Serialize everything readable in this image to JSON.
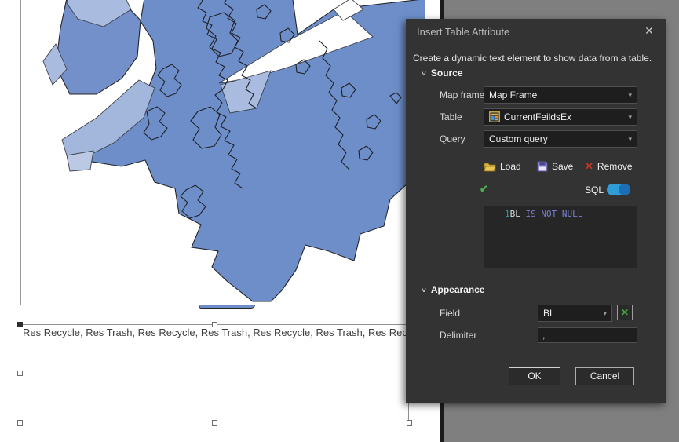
{
  "window": {
    "title": "Insert Table Attribute",
    "close_glyph": "✕"
  },
  "dialog": {
    "subtitle": "Create a dynamic text element to show data from a table.",
    "source": {
      "header": "Source",
      "map_frame_label": "Map frame",
      "map_frame_value": "Map Frame",
      "table_label": "Table",
      "table_value": "CurrentFeildsEx",
      "query_label": "Query",
      "query_value": "Custom query",
      "load_label": "Load",
      "save_label": "Save",
      "remove_label": "Remove",
      "sql_toggle_label": "SQL",
      "sql": {
        "line_number": "1",
        "field": "BL",
        "clause": "IS NOT NULL"
      }
    },
    "appearance": {
      "header": "Appearance",
      "field_label": "Field",
      "field_value": "BL",
      "delimiter_label": "Delimiter",
      "delimiter_value": ","
    },
    "buttons": {
      "ok": "OK",
      "cancel": "Cancel"
    }
  },
  "canvas": {
    "text_element": "Res Recycle, Res Trash, Res Recycle, Res Trash, Res Recycle, Res Trash, Res Recycle, Res Trash, Res Recycle, Res Trash"
  },
  "icons": {
    "chevron_down": "∨",
    "dropdown_caret": "▾",
    "check": "✔",
    "remove_x": "✕",
    "expression_x": "✕"
  },
  "colors": {
    "accent_blue": "#2f9bd7",
    "toggle_knob_blue": "#1b6fb5",
    "valid_green": "#4caf50",
    "expression_green": "#43a047",
    "remove_red": "#c0392b",
    "sql_lineno": "#2e9d9d",
    "sql_field": "#dcdcdc",
    "sql_keyword": "#7b7fd0"
  },
  "map": {
    "colors": {
      "base": "#6d8ec9",
      "left_cluster": "#7490cb",
      "light": "#a9bcdf",
      "lighter": "#bcc9e5",
      "arm": "#a3b6dc",
      "dark_patch": "#5d80c0",
      "white": "#ffffff"
    }
  }
}
